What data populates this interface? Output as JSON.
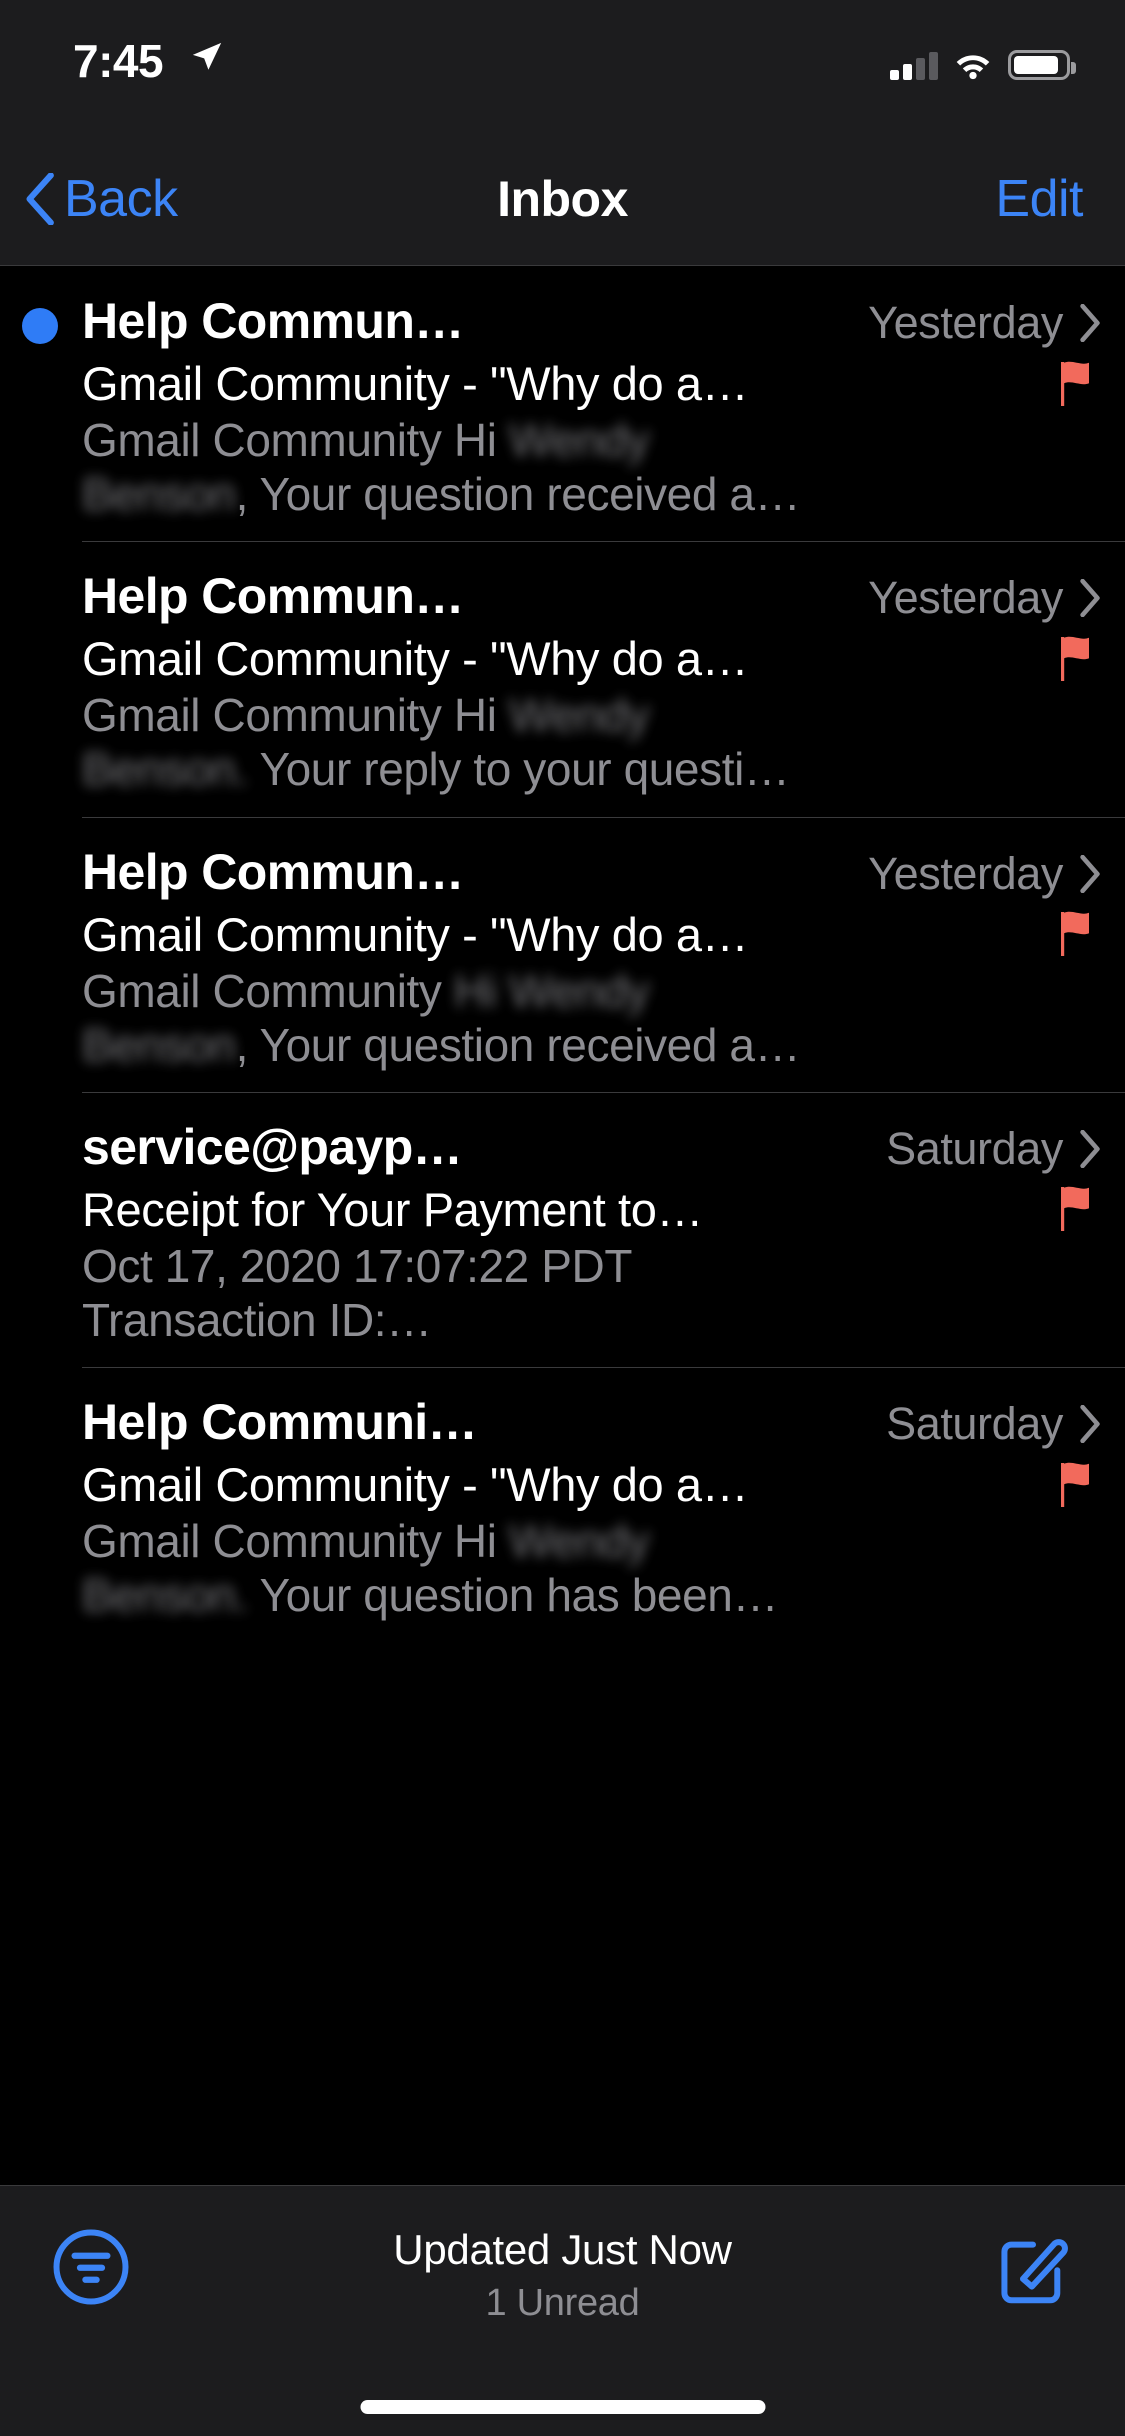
{
  "status_bar": {
    "time": "7:45",
    "location_icon": "location-arrow-icon",
    "cellular_bars": 2,
    "wifi_icon": "wifi-icon",
    "battery_icon": "battery-icon",
    "battery_level_pct": 88
  },
  "nav": {
    "back_label": "Back",
    "title": "Inbox",
    "edit_label": "Edit",
    "accent_color": "#3c84f6"
  },
  "colors": {
    "accent": "#3c84f6",
    "unread_dot": "#2f7cf6",
    "flag": "#f26a5c",
    "secondary_text": "#8e8e93",
    "bar_background": "#1c1c1e",
    "separator": "#3a3a3c"
  },
  "mail_list": [
    {
      "unread": true,
      "sender": "Help Commun…",
      "date": "Yesterday",
      "subject": "Gmail Community - \"Why do a…",
      "preview_line1_plain": "Gmail Community Hi",
      "preview_line1_redacted": "Wendy",
      "preview_line2_redacted": "Benson",
      "preview_line2_plain": ", Your question received a…",
      "flagged": true
    },
    {
      "unread": false,
      "sender": "Help Commun…",
      "date": "Yesterday",
      "subject": "Gmail Community - \"Why do a…",
      "preview_line1_plain": "Gmail Community Hi",
      "preview_line1_redacted": "Wendy",
      "preview_line2_redacted": "Benson.",
      "preview_line2_plain": " Your reply to your questi…",
      "flagged": true
    },
    {
      "unread": false,
      "sender": "Help Commun…",
      "date": "Yesterday",
      "subject": "Gmail Community - \"Why do a…",
      "preview_line1_plain": "Gmail Community",
      "preview_line1_redacted": "Hi Wendy",
      "preview_line2_redacted": "Benson",
      "preview_line2_plain": ", Your question received a…",
      "flagged": true
    },
    {
      "unread": false,
      "sender": "service@payp…",
      "date": "Saturday",
      "subject": "Receipt for Your Payment to…",
      "preview_line1_plain": "Oct 17, 2020 17:07:22 PDT",
      "preview_line1_redacted": "",
      "preview_line2_redacted": "",
      "preview_line2_plain": "Transaction ID:…",
      "flagged": true
    },
    {
      "unread": false,
      "sender": "Help Communi…",
      "date": "Saturday",
      "subject": "Gmail Community - \"Why do a…",
      "preview_line1_plain": "Gmail Community Hi",
      "preview_line1_redacted": "Wendy",
      "preview_line2_redacted": "Benson.",
      "preview_line2_plain": " Your question has been…",
      "flagged": true
    }
  ],
  "toolbar": {
    "filter_icon": "filter-icon",
    "status_title": "Updated Just Now",
    "status_subtitle": "1 Unread",
    "compose_icon": "compose-icon"
  }
}
